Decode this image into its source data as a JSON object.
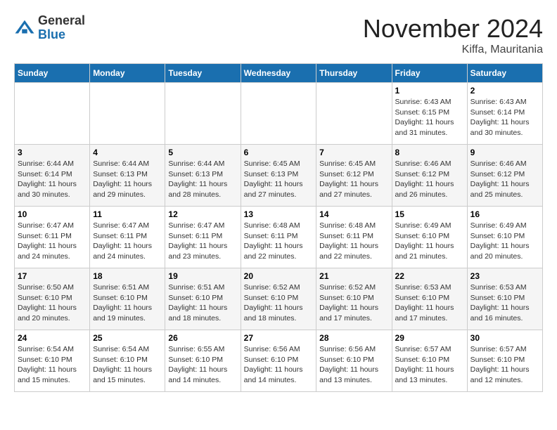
{
  "header": {
    "logo_general": "General",
    "logo_blue": "Blue",
    "month_title": "November 2024",
    "location": "Kiffa, Mauritania"
  },
  "days_of_week": [
    "Sunday",
    "Monday",
    "Tuesday",
    "Wednesday",
    "Thursday",
    "Friday",
    "Saturday"
  ],
  "weeks": [
    [
      {
        "day": "",
        "info": ""
      },
      {
        "day": "",
        "info": ""
      },
      {
        "day": "",
        "info": ""
      },
      {
        "day": "",
        "info": ""
      },
      {
        "day": "",
        "info": ""
      },
      {
        "day": "1",
        "info": "Sunrise: 6:43 AM\nSunset: 6:15 PM\nDaylight: 11 hours and 31 minutes."
      },
      {
        "day": "2",
        "info": "Sunrise: 6:43 AM\nSunset: 6:14 PM\nDaylight: 11 hours and 30 minutes."
      }
    ],
    [
      {
        "day": "3",
        "info": "Sunrise: 6:44 AM\nSunset: 6:14 PM\nDaylight: 11 hours and 30 minutes."
      },
      {
        "day": "4",
        "info": "Sunrise: 6:44 AM\nSunset: 6:13 PM\nDaylight: 11 hours and 29 minutes."
      },
      {
        "day": "5",
        "info": "Sunrise: 6:44 AM\nSunset: 6:13 PM\nDaylight: 11 hours and 28 minutes."
      },
      {
        "day": "6",
        "info": "Sunrise: 6:45 AM\nSunset: 6:13 PM\nDaylight: 11 hours and 27 minutes."
      },
      {
        "day": "7",
        "info": "Sunrise: 6:45 AM\nSunset: 6:12 PM\nDaylight: 11 hours and 27 minutes."
      },
      {
        "day": "8",
        "info": "Sunrise: 6:46 AM\nSunset: 6:12 PM\nDaylight: 11 hours and 26 minutes."
      },
      {
        "day": "9",
        "info": "Sunrise: 6:46 AM\nSunset: 6:12 PM\nDaylight: 11 hours and 25 minutes."
      }
    ],
    [
      {
        "day": "10",
        "info": "Sunrise: 6:47 AM\nSunset: 6:11 PM\nDaylight: 11 hours and 24 minutes."
      },
      {
        "day": "11",
        "info": "Sunrise: 6:47 AM\nSunset: 6:11 PM\nDaylight: 11 hours and 24 minutes."
      },
      {
        "day": "12",
        "info": "Sunrise: 6:47 AM\nSunset: 6:11 PM\nDaylight: 11 hours and 23 minutes."
      },
      {
        "day": "13",
        "info": "Sunrise: 6:48 AM\nSunset: 6:11 PM\nDaylight: 11 hours and 22 minutes."
      },
      {
        "day": "14",
        "info": "Sunrise: 6:48 AM\nSunset: 6:11 PM\nDaylight: 11 hours and 22 minutes."
      },
      {
        "day": "15",
        "info": "Sunrise: 6:49 AM\nSunset: 6:10 PM\nDaylight: 11 hours and 21 minutes."
      },
      {
        "day": "16",
        "info": "Sunrise: 6:49 AM\nSunset: 6:10 PM\nDaylight: 11 hours and 20 minutes."
      }
    ],
    [
      {
        "day": "17",
        "info": "Sunrise: 6:50 AM\nSunset: 6:10 PM\nDaylight: 11 hours and 20 minutes."
      },
      {
        "day": "18",
        "info": "Sunrise: 6:51 AM\nSunset: 6:10 PM\nDaylight: 11 hours and 19 minutes."
      },
      {
        "day": "19",
        "info": "Sunrise: 6:51 AM\nSunset: 6:10 PM\nDaylight: 11 hours and 18 minutes."
      },
      {
        "day": "20",
        "info": "Sunrise: 6:52 AM\nSunset: 6:10 PM\nDaylight: 11 hours and 18 minutes."
      },
      {
        "day": "21",
        "info": "Sunrise: 6:52 AM\nSunset: 6:10 PM\nDaylight: 11 hours and 17 minutes."
      },
      {
        "day": "22",
        "info": "Sunrise: 6:53 AM\nSunset: 6:10 PM\nDaylight: 11 hours and 17 minutes."
      },
      {
        "day": "23",
        "info": "Sunrise: 6:53 AM\nSunset: 6:10 PM\nDaylight: 11 hours and 16 minutes."
      }
    ],
    [
      {
        "day": "24",
        "info": "Sunrise: 6:54 AM\nSunset: 6:10 PM\nDaylight: 11 hours and 15 minutes."
      },
      {
        "day": "25",
        "info": "Sunrise: 6:54 AM\nSunset: 6:10 PM\nDaylight: 11 hours and 15 minutes."
      },
      {
        "day": "26",
        "info": "Sunrise: 6:55 AM\nSunset: 6:10 PM\nDaylight: 11 hours and 14 minutes."
      },
      {
        "day": "27",
        "info": "Sunrise: 6:56 AM\nSunset: 6:10 PM\nDaylight: 11 hours and 14 minutes."
      },
      {
        "day": "28",
        "info": "Sunrise: 6:56 AM\nSunset: 6:10 PM\nDaylight: 11 hours and 13 minutes."
      },
      {
        "day": "29",
        "info": "Sunrise: 6:57 AM\nSunset: 6:10 PM\nDaylight: 11 hours and 13 minutes."
      },
      {
        "day": "30",
        "info": "Sunrise: 6:57 AM\nSunset: 6:10 PM\nDaylight: 11 hours and 12 minutes."
      }
    ]
  ]
}
